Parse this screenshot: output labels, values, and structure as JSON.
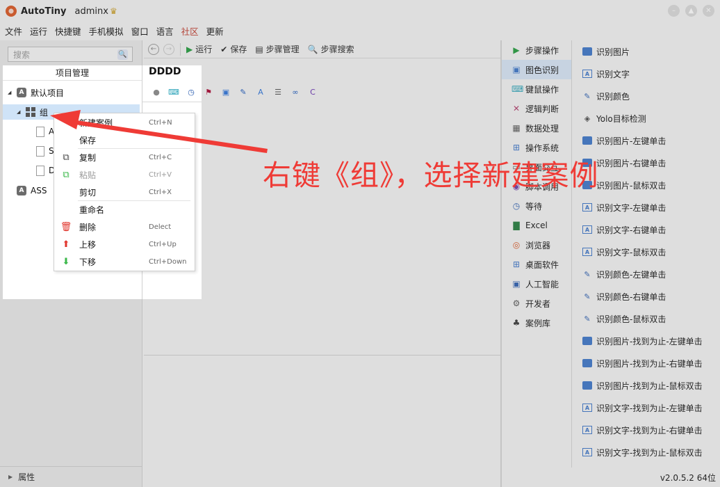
{
  "window": {
    "app_title": "AutoTiny",
    "user": "adminx"
  },
  "menu": [
    "文件",
    "运行",
    "快捷键",
    "手机模拟",
    "窗口",
    "语言",
    "社区",
    "更新"
  ],
  "left_panel": {
    "search_placeholder": "搜索",
    "header": "项目管理",
    "tree": {
      "default_project": "默认项目",
      "group": "组",
      "children_initials": [
        "A",
        "S",
        "D"
      ],
      "other_project": "ASS"
    },
    "properties_label": "属性"
  },
  "toolbar": {
    "run": "运行",
    "save": "保存",
    "step_manage": "步骤管理",
    "step_search": "步骤搜索"
  },
  "case_editor": {
    "title": "DDDD"
  },
  "context_menu": {
    "items": [
      {
        "label": "新建案例",
        "shortcut": "Ctrl+N"
      },
      {
        "label": "保存",
        "shortcut": ""
      },
      {
        "label": "复制",
        "shortcut": "Ctrl+C"
      },
      {
        "label": "粘贴",
        "shortcut": "Ctrl+V"
      },
      {
        "label": "剪切",
        "shortcut": "Ctrl+X"
      },
      {
        "label": "重命名",
        "shortcut": ""
      },
      {
        "label": "删除",
        "shortcut": "Delect"
      },
      {
        "label": "上移",
        "shortcut": "Ctrl+Up"
      },
      {
        "label": "下移",
        "shortcut": "Ctrl+Down"
      }
    ]
  },
  "categories": [
    {
      "label": "步骤操作",
      "icon": "play-icon"
    },
    {
      "label": "图色识别",
      "icon": "image-icon"
    },
    {
      "label": "键鼠操作",
      "icon": "keyboard-icon"
    },
    {
      "label": "逻辑判断",
      "icon": "shuffle-icon"
    },
    {
      "label": "数据处理",
      "icon": "data-icon"
    },
    {
      "label": "操作系统",
      "icon": "windows-icon"
    },
    {
      "label": "界面交互",
      "icon": "ui-icon"
    },
    {
      "label": "脚本调用",
      "icon": "script-icon"
    },
    {
      "label": "等待",
      "icon": "clock-icon"
    },
    {
      "label": "Excel",
      "icon": "excel-icon"
    },
    {
      "label": "浏览器",
      "icon": "chrome-icon"
    },
    {
      "label": "桌面软件",
      "icon": "windows-icon"
    },
    {
      "label": "人工智能",
      "icon": "ai-icon"
    },
    {
      "label": "开发者",
      "icon": "developer-icon"
    },
    {
      "label": "案例库",
      "icon": "library-icon"
    }
  ],
  "actions": [
    {
      "label": "识别图片",
      "icon": "image"
    },
    {
      "label": "识别文字",
      "icon": "text"
    },
    {
      "label": "识别颜色",
      "icon": "pipette"
    },
    {
      "label": "Yolo目标检测",
      "icon": "yolo"
    },
    {
      "label": "识别图片-左键单击",
      "icon": "image"
    },
    {
      "label": "识别图片-右键单击",
      "icon": "image"
    },
    {
      "label": "识别图片-鼠标双击",
      "icon": "image"
    },
    {
      "label": "识别文字-左键单击",
      "icon": "text"
    },
    {
      "label": "识别文字-右键单击",
      "icon": "text"
    },
    {
      "label": "识别文字-鼠标双击",
      "icon": "text"
    },
    {
      "label": "识别颜色-左键单击",
      "icon": "pipette"
    },
    {
      "label": "识别颜色-右键单击",
      "icon": "pipette"
    },
    {
      "label": "识别颜色-鼠标双击",
      "icon": "pipette"
    },
    {
      "label": "识别图片-找到为止-左键单击",
      "icon": "image"
    },
    {
      "label": "识别图片-找到为止-右键单击",
      "icon": "image"
    },
    {
      "label": "识别图片-找到为止-鼠标双击",
      "icon": "image"
    },
    {
      "label": "识别文字-找到为止-左键单击",
      "icon": "text"
    },
    {
      "label": "识别文字-找到为止-右键单击",
      "icon": "text"
    },
    {
      "label": "识别文字-找到为止-鼠标双击",
      "icon": "text"
    }
  ],
  "status": {
    "version": "v2.0.5.2 64位"
  },
  "annotation": {
    "text": "右键《组》，选择新建案例",
    "color": "#ef3b36"
  }
}
